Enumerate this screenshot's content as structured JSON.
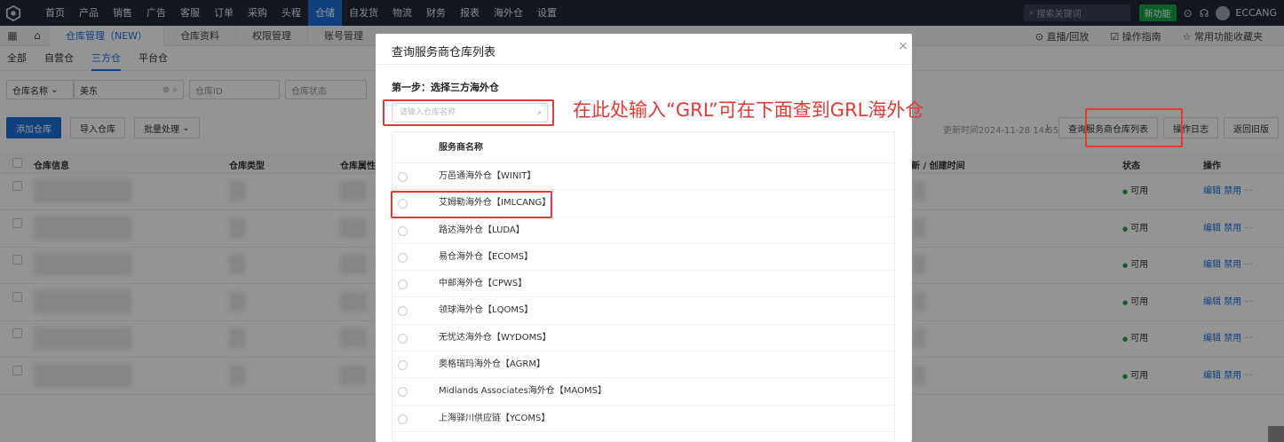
{
  "topnav": {
    "items": [
      "首页",
      "产品",
      "销售",
      "广告",
      "客服",
      "订单",
      "采购",
      "头程",
      "仓储",
      "自发货",
      "物流",
      "财务",
      "报表",
      "海外仓",
      "设置"
    ],
    "active_index": 8,
    "search_placeholder": "搜索关键词",
    "new_feature": "新功能",
    "username": "ECCANG"
  },
  "secondbar": {
    "tabs": [
      "仓库管理（NEW）",
      "仓库资料",
      "权限管理",
      "账号管理"
    ],
    "right": [
      "直播/回放",
      "操作指南",
      "常用功能收藏夹"
    ]
  },
  "subtabs": [
    "全部",
    "自营仓",
    "三方仓",
    "平台仓"
  ],
  "filters": {
    "field": "仓库名称",
    "value": "美东",
    "warehouse_id": "仓库ID",
    "warehouse_status": "仓库状态"
  },
  "actions": {
    "add": "添加仓库",
    "import": "导入仓库",
    "batch": "批量处理",
    "updated": "更新时间2024-11-28 14:55:42",
    "query_list": "查询服务商仓库列表",
    "log": "操作日志",
    "old": "返回旧版"
  },
  "table": {
    "headers": [
      "仓库信息",
      "仓库类型",
      "仓库属性",
      "新 / 创建时间",
      "状态",
      "操作"
    ],
    "rows": 6,
    "status": "可用",
    "edit": "编辑",
    "disable": "禁用"
  },
  "modal": {
    "title": "查询服务商仓库列表",
    "step": "第一步：选择三方海外仓",
    "search_placeholder": "请输入仓库名称",
    "column": "服务商名称",
    "providers": [
      "万邑通海外仓【WINIT】",
      "艾姆勒海外仓【IMLCANG】",
      "路达海外仓【LUDA】",
      "易仓海外仓【ECOMS】",
      "中邮海外仓【CPWS】",
      "领球海外仓【LQOMS】",
      "无忧达海外仓【WYDOMS】",
      "奥格瑞玛海外仓【AGRM】",
      "Midlands Associates海外仓【MAOMS】",
      "上海驿川供应链【YCOMS】"
    ]
  },
  "annotation": "在此处输入“GRL”可在下面查到GRL海外仓",
  "colors": {
    "accent": "#1e6fd9",
    "highlight": "#e53935",
    "nav_bg": "#1f2937"
  }
}
